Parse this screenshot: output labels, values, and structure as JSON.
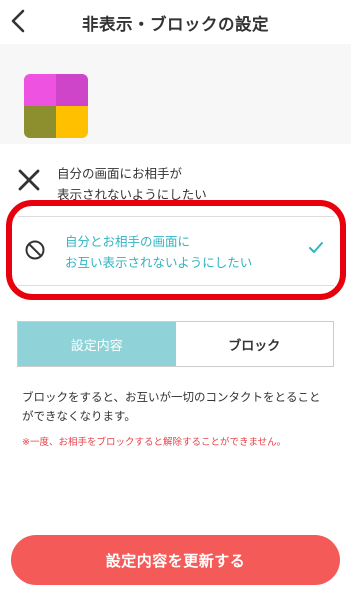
{
  "header": {
    "title": "非表示・ブロックの設定",
    "back_icon": "chevron-left-icon"
  },
  "options": [
    {
      "icon": "x-icon",
      "label": "自分の画面にお相手が\n表示されないようにしたい",
      "selected": false
    },
    {
      "icon": "block-icon",
      "label": "自分とお相手の画面に\nお互い表示されないようにしたい",
      "selected": true,
      "selected_icon": "check-icon"
    }
  ],
  "tabs": [
    {
      "label": "設定内容",
      "active": true
    },
    {
      "label": "ブロック",
      "active": false
    }
  ],
  "description": "ブロックをすると、お互いが一切のコンタクトをとることができなくなります。",
  "warning": "※一度、お相手をブロックすると解除することができません。",
  "cta": {
    "label": "設定内容を更新する"
  },
  "colors": {
    "accent_teal": "#2fb5c2",
    "tab_active": "#8fd3d8",
    "cta": "#f45a57",
    "highlight_border": "#e8000d",
    "warning_text": "#e8424a"
  }
}
